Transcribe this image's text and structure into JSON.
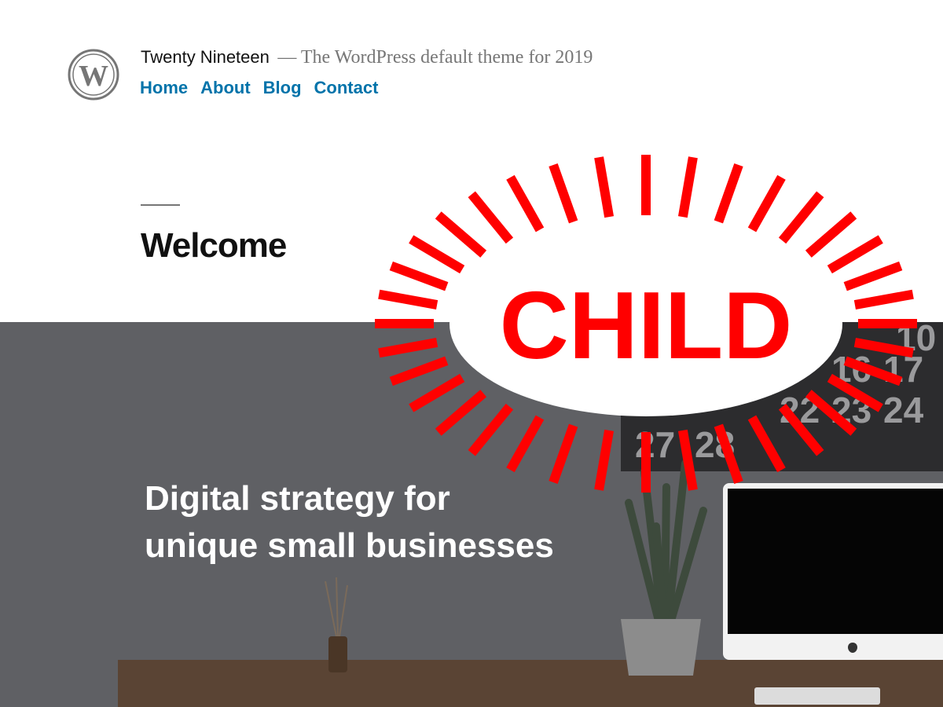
{
  "site": {
    "title": "Twenty Nineteen",
    "tagline": "— The WordPress default theme for 2019"
  },
  "nav": [
    {
      "label": "Home"
    },
    {
      "label": "About"
    },
    {
      "label": "Blog"
    },
    {
      "label": "Contact"
    }
  ],
  "page": {
    "title": "Welcome"
  },
  "hero": {
    "line1": "Digital strategy for",
    "line2": "unique small businesses",
    "calendar_numbers": [
      "10",
      "16",
      "17",
      "22",
      "23",
      "24",
      "27",
      "28"
    ]
  },
  "badge": {
    "text": "CHILD"
  },
  "colors": {
    "link": "#0073aa",
    "badge_red": "#ff0000",
    "hero_overlay": "#5f6064"
  },
  "icons": {
    "logo": "wordpress-logo-icon"
  }
}
